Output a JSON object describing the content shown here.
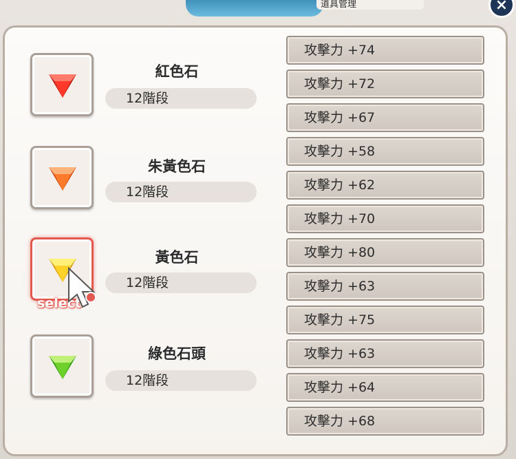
{
  "header": {
    "close_label": "×",
    "tab_text": "道具管理"
  },
  "stones": [
    {
      "name": "紅色石",
      "level": "12階段",
      "color_top": "#ff5a4a",
      "color_bottom": "#c0140c"
    },
    {
      "name": "朱黃色石",
      "level": "12階段",
      "color_top": "#ff9a4a",
      "color_bottom": "#d24a10"
    },
    {
      "name": "黃色石",
      "level": "12階段",
      "color_top": "#ffe45a",
      "color_bottom": "#d69a0c"
    },
    {
      "name": "綠色石頭",
      "level": "12階段",
      "color_top": "#8ee04a",
      "color_bottom": "#2f9a14"
    }
  ],
  "select_label": "select",
  "stats": [
    "攻擊力 +74",
    "攻擊力 +72",
    "攻擊力 +67",
    "攻擊力 +58",
    "攻擊力 +62",
    "攻擊力 +70",
    "攻擊力 +80",
    "攻擊力 +63",
    "攻擊力 +75",
    "攻擊力 +63",
    "攻擊力 +64",
    "攻擊力 +68"
  ]
}
